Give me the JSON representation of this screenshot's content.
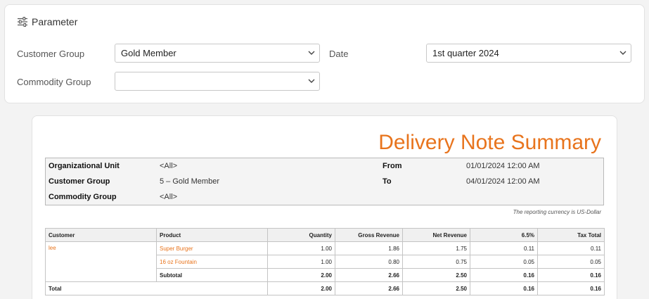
{
  "parameter": {
    "title": "Parameter",
    "customer_group_label": "Customer Group",
    "customer_group_value": "Gold Member",
    "date_label": "Date",
    "date_value": "1st quarter 2024",
    "commodity_group_label": "Commodity Group",
    "commodity_group_value": ""
  },
  "report": {
    "title": "Delivery Note Summary",
    "info": {
      "org_unit_label": "Organizational Unit",
      "org_unit_value": "<All>",
      "customer_group_label": "Customer Group",
      "customer_group_value": "5 – Gold Member",
      "commodity_group_label": "Commodity Group",
      "commodity_group_value": "<All>",
      "from_label": "From",
      "from_value": "01/01/2024 12:00 AM",
      "to_label": "To",
      "to_value": "04/01/2024 12:00 AM"
    },
    "currency_note": "The reporting currency is US-Dollar",
    "table": {
      "headers": [
        "Customer",
        "Product",
        "Quantity",
        "Gross Revenue",
        "Net Revenue",
        "6.5%",
        "Tax Total"
      ],
      "customer": "lee",
      "rows": [
        {
          "product": "Super Burger",
          "quantity": "1.00",
          "gross": "1.86",
          "net": "1.75",
          "tax": "0.11",
          "tax_total": "0.11"
        },
        {
          "product": "16 oz Fountain",
          "quantity": "1.00",
          "gross": "0.80",
          "net": "0.75",
          "tax": "0.05",
          "tax_total": "0.05"
        }
      ],
      "subtotal": {
        "label": "Subtotal",
        "quantity": "2.00",
        "gross": "2.66",
        "net": "2.50",
        "tax": "0.16",
        "tax_total": "0.16"
      },
      "total": {
        "label": "Total",
        "quantity": "2.00",
        "gross": "2.66",
        "net": "2.50",
        "tax": "0.16",
        "tax_total": "0.16"
      }
    }
  }
}
